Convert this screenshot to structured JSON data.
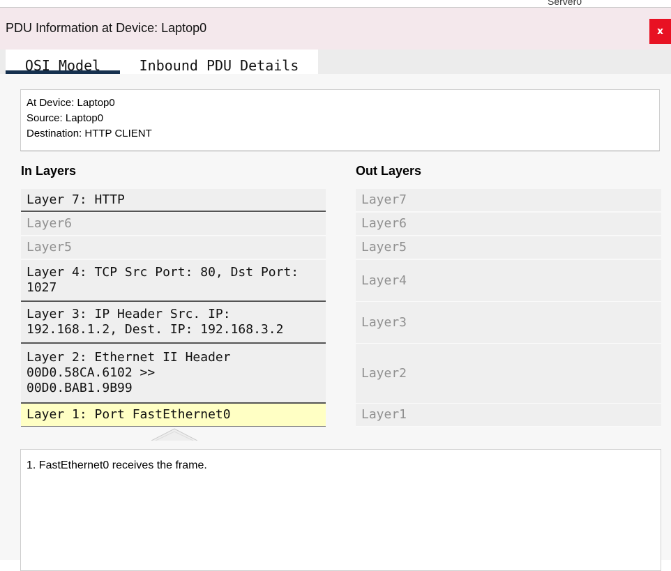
{
  "background": {
    "server_label": "Server0"
  },
  "window": {
    "title": "PDU Information at Device: Laptop0",
    "close_label": "x",
    "close_color": "#e81123",
    "titlebar_color": "#f4e8ec"
  },
  "tabs": [
    {
      "label": "OSI Model",
      "selected": true
    },
    {
      "label": "Inbound PDU Details",
      "selected": false
    }
  ],
  "tab_underline_color": "#15304e",
  "info": {
    "lines": [
      "At Device: Laptop0",
      "Source: Laptop0",
      "Destination: HTTP CLIENT"
    ]
  },
  "in_layers": {
    "header": "In Layers",
    "items": [
      {
        "label": "Layer 7: HTTP",
        "state": "active"
      },
      {
        "label": "Layer6",
        "state": "inactive"
      },
      {
        "label": "Layer5",
        "state": "inactive"
      },
      {
        "label": "Layer 4: TCP Src Port: 80, Dst Port:\n1027",
        "state": "active"
      },
      {
        "label": "Layer 3: IP Header Src. IP:\n192.168.1.2, Dest. IP: 192.168.3.2",
        "state": "active"
      },
      {
        "label": "Layer 2: Ethernet II Header\n00D0.58CA.6102 >>\n00D0.BAB1.9B99",
        "state": "active"
      },
      {
        "label": "Layer 1: Port FastEthernet0",
        "state": "selected"
      }
    ]
  },
  "out_layers": {
    "header": "Out Layers",
    "items": [
      {
        "label": "Layer7"
      },
      {
        "label": "Layer6"
      },
      {
        "label": "Layer5"
      },
      {
        "label": "Layer4"
      },
      {
        "label": "Layer3"
      },
      {
        "label": "Layer2"
      },
      {
        "label": "Layer1"
      }
    ]
  },
  "selected_highlight_color": "#ffffc4",
  "description": {
    "text": "1. FastEthernet0 receives the frame."
  }
}
